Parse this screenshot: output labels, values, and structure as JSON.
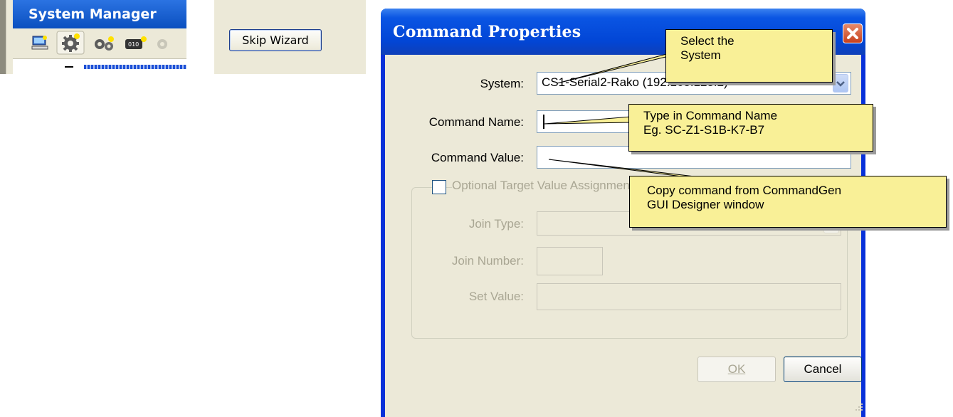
{
  "system_manager": {
    "title": "System Manager",
    "toolbar_icons": [
      "computer-icon",
      "gear-icon",
      "gears-icon",
      "command-icon",
      "gear-disabled-icon"
    ]
  },
  "skip_wizard": {
    "label": "Skip Wizard"
  },
  "dialog": {
    "title": "Command Properties",
    "system_label": "System:",
    "system_value": "CS1-Serial2-Rako (192.168.123.2)",
    "command_name_label": "Command Name:",
    "command_name_value": "",
    "command_value_label": "Command Value:",
    "command_value_value": "",
    "optional_group_label": "Optional Target Value Assignment",
    "join_type_label": "Join Type:",
    "join_number_label": "Join Number:",
    "set_value_label": "Set Value:",
    "ok_label": "OK",
    "cancel_label": "Cancel"
  },
  "callouts": {
    "select_system": "Select the\nSystem",
    "type_command_name": "Type in Command Name\nEg. SC-Z1-S1B-K7-B7",
    "copy_command": "Copy command from CommandGen\nGUI Designer window"
  },
  "colors": {
    "titlebar_blue": "#0a55e3",
    "dialog_face": "#ece9d8",
    "callout_fill": "#f9f097",
    "close_red": "#c8401c"
  }
}
